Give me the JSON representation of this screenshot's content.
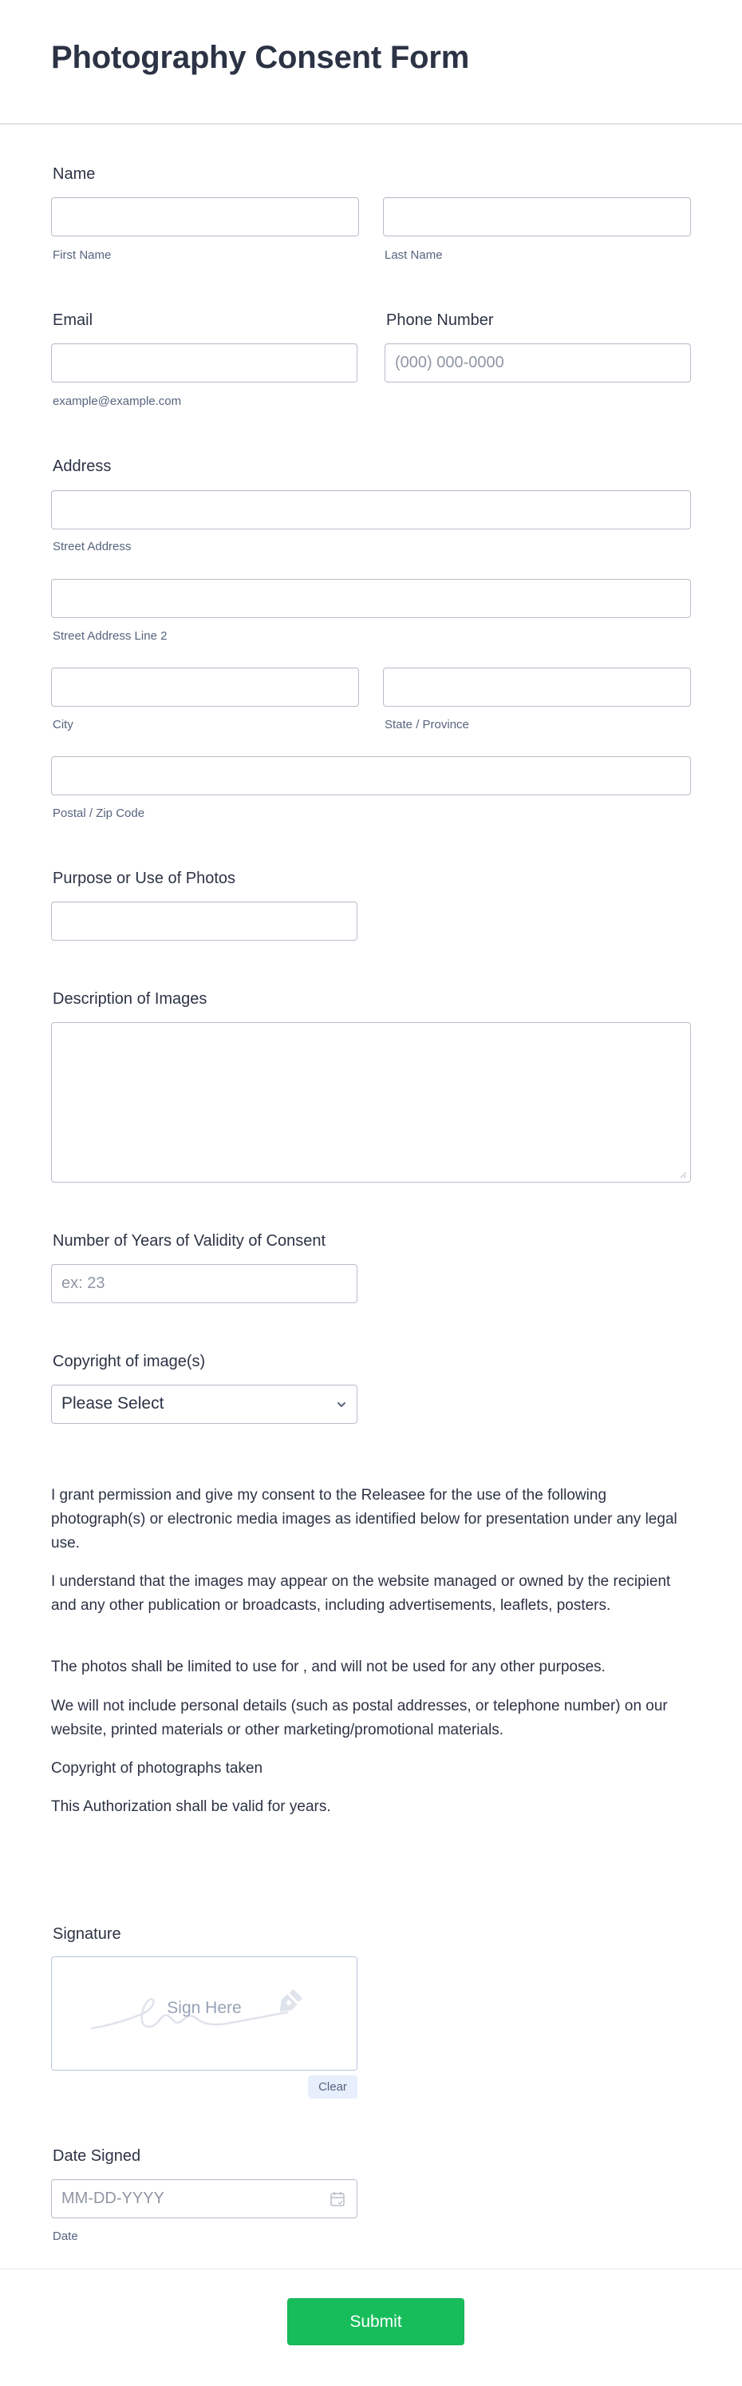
{
  "header": {
    "title": "Photography Consent Form"
  },
  "fields": {
    "name": {
      "label": "Name",
      "first_sublabel": "First Name",
      "last_sublabel": "Last Name",
      "first_value": "",
      "last_value": ""
    },
    "email": {
      "label": "Email",
      "sublabel": "example@example.com",
      "value": ""
    },
    "phone": {
      "label": "Phone Number",
      "placeholder": "(000) 000-0000"
    },
    "address": {
      "label": "Address",
      "street_sublabel": "Street Address",
      "street2_sublabel": "Street Address Line 2",
      "city_sublabel": "City",
      "state_sublabel": "State / Province",
      "zip_sublabel": "Postal / Zip Code"
    },
    "purpose": {
      "label": "Purpose or Use of Photos",
      "value": ""
    },
    "description": {
      "label": "Description of Images",
      "value": ""
    },
    "years": {
      "label": "Number of Years of Validity of Consent",
      "placeholder": "ex: 23"
    },
    "copyright": {
      "label": "Copyright of image(s)",
      "selected": "Please Select"
    }
  },
  "consent_text": [
    "I grant permission and give my consent to the Releasee for the use of the following photograph(s) or electronic media images as identified below for presentation under any legal use.",
    "I understand that the images may appear on the website managed or owned by the recipient and any other publication or broadcasts, including advertisements, leaflets, posters.",
    "The photos shall be limited to use for , and will not be used for any other purposes.",
    "We will not include personal details (such as postal addresses, or telephone number) on our website, printed materials or other marketing/promotional materials.",
    "Copyright of photographs taken",
    "This Authorization shall be valid for  years."
  ],
  "signature": {
    "label": "Signature",
    "placeholder": "Sign Here",
    "clear_label": "Clear"
  },
  "date_signed": {
    "label": "Date Signed",
    "placeholder": "MM-DD-YYYY",
    "sublabel": "Date"
  },
  "submit": {
    "label": "Submit"
  },
  "colors": {
    "submit_green": "#18bd5b",
    "text_dark": "#2c3345",
    "sublabel_gray": "#57647e",
    "input_border": "#b8bdc9"
  }
}
